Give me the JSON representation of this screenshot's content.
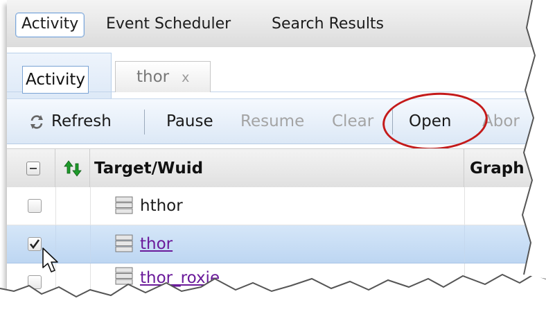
{
  "top_tabs": [
    {
      "label": "Activity",
      "active": true
    },
    {
      "label": "Event Scheduler",
      "active": false
    },
    {
      "label": "Search Results",
      "active": false
    }
  ],
  "sub_tabs": [
    {
      "label": "Activity",
      "active": true
    },
    {
      "label": "thor",
      "active": false,
      "close": "x"
    }
  ],
  "toolbar": {
    "refresh": "Refresh",
    "pause": "Pause",
    "resume": "Resume",
    "clear": "Clear",
    "open": "Open",
    "abort": "Abor"
  },
  "grid": {
    "headers": {
      "target": "Target/Wuid",
      "graph": "Graph"
    },
    "rows": [
      {
        "label": "hthor",
        "checked": false,
        "link": false
      },
      {
        "label": "thor",
        "checked": true,
        "link": true
      },
      {
        "label": "thor_roxie",
        "checked": false,
        "link": true
      }
    ]
  },
  "colors": {
    "highlight_circle": "#c41a1a",
    "selected_row": "#c9def5",
    "link": "#6a1a9a",
    "sort_icon": "#1d9a2a"
  },
  "icons": [
    "refresh-icon",
    "sort-arrows-icon",
    "server-icon",
    "mouse-cursor-icon",
    "close-icon",
    "collapse-icon"
  ]
}
